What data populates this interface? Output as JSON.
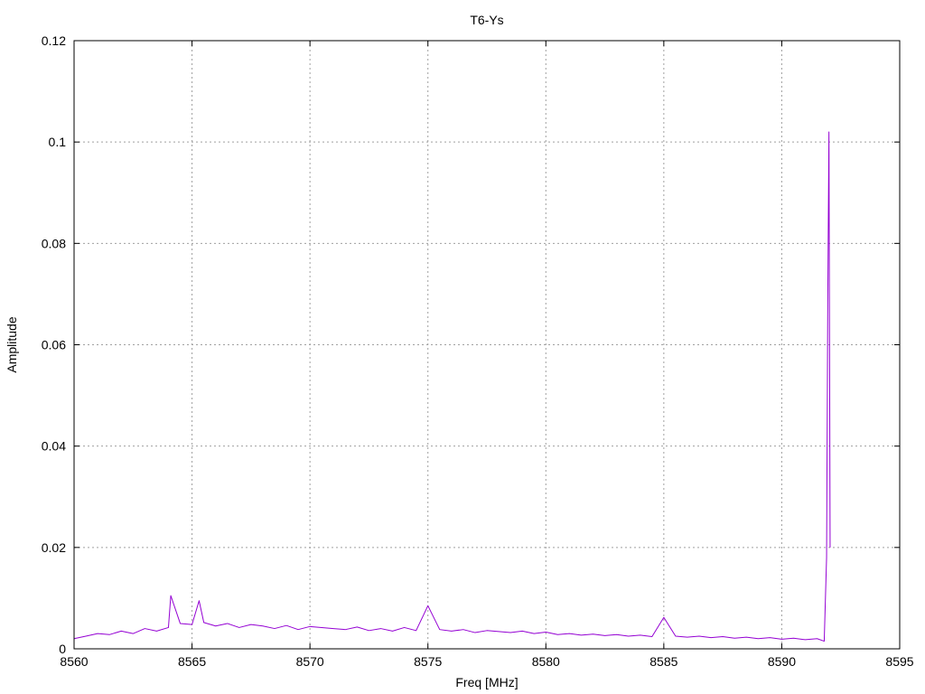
{
  "chart_data": {
    "type": "line",
    "title": "T6-Ys",
    "xlabel": "Freq [MHz]",
    "ylabel": "Amplitude",
    "xlim": [
      8560,
      8595
    ],
    "ylim": [
      0,
      0.12
    ],
    "xticks": [
      "8560",
      "8565",
      "8570",
      "8575",
      "8580",
      "8585",
      "8590",
      "8595"
    ],
    "yticks": [
      "0",
      "0.02",
      "0.04",
      "0.06",
      "0.08",
      "0.1",
      "0.12"
    ],
    "grid": true,
    "series": [
      {
        "color": "#9400d3",
        "x": [
          8560.0,
          8560.5,
          8561.0,
          8561.5,
          8562.0,
          8562.5,
          8563.0,
          8563.5,
          8564.0,
          8564.1,
          8564.5,
          8565.0,
          8565.3,
          8565.5,
          8566.0,
          8566.5,
          8567.0,
          8567.5,
          8568.0,
          8568.5,
          8569.0,
          8569.5,
          8570.0,
          8570.5,
          8571.0,
          8571.5,
          8572.0,
          8572.5,
          8573.0,
          8573.5,
          8574.0,
          8574.5,
          8575.0,
          8575.5,
          8576.0,
          8576.5,
          8577.0,
          8577.5,
          8578.0,
          8578.5,
          8579.0,
          8579.5,
          8580.0,
          8580.5,
          8581.0,
          8581.5,
          8582.0,
          8582.5,
          8583.0,
          8583.5,
          8584.0,
          8584.5,
          8585.0,
          8585.5,
          8586.0,
          8586.5,
          8587.0,
          8587.5,
          8588.0,
          8588.5,
          8589.0,
          8589.5,
          8590.0,
          8590.5,
          8591.0,
          8591.5,
          8591.8,
          8591.9,
          8591.95,
          8592.0,
          8592.05
        ],
        "y": [
          0.002,
          0.0025,
          0.003,
          0.0028,
          0.0035,
          0.003,
          0.004,
          0.0035,
          0.0042,
          0.0105,
          0.005,
          0.0048,
          0.0095,
          0.0052,
          0.0045,
          0.005,
          0.0042,
          0.0048,
          0.0045,
          0.004,
          0.0046,
          0.0038,
          0.0044,
          0.0042,
          0.004,
          0.0038,
          0.0043,
          0.0036,
          0.004,
          0.0035,
          0.0042,
          0.0036,
          0.0085,
          0.0038,
          0.0035,
          0.0038,
          0.0032,
          0.0036,
          0.0034,
          0.0032,
          0.0035,
          0.003,
          0.0033,
          0.0028,
          0.003,
          0.0027,
          0.0029,
          0.0026,
          0.0028,
          0.0025,
          0.0027,
          0.0024,
          0.0062,
          0.0025,
          0.0023,
          0.0025,
          0.0022,
          0.0024,
          0.0021,
          0.0023,
          0.002,
          0.0022,
          0.0019,
          0.0021,
          0.0018,
          0.002,
          0.0015,
          0.018,
          0.068,
          0.102,
          0.02
        ]
      }
    ]
  }
}
